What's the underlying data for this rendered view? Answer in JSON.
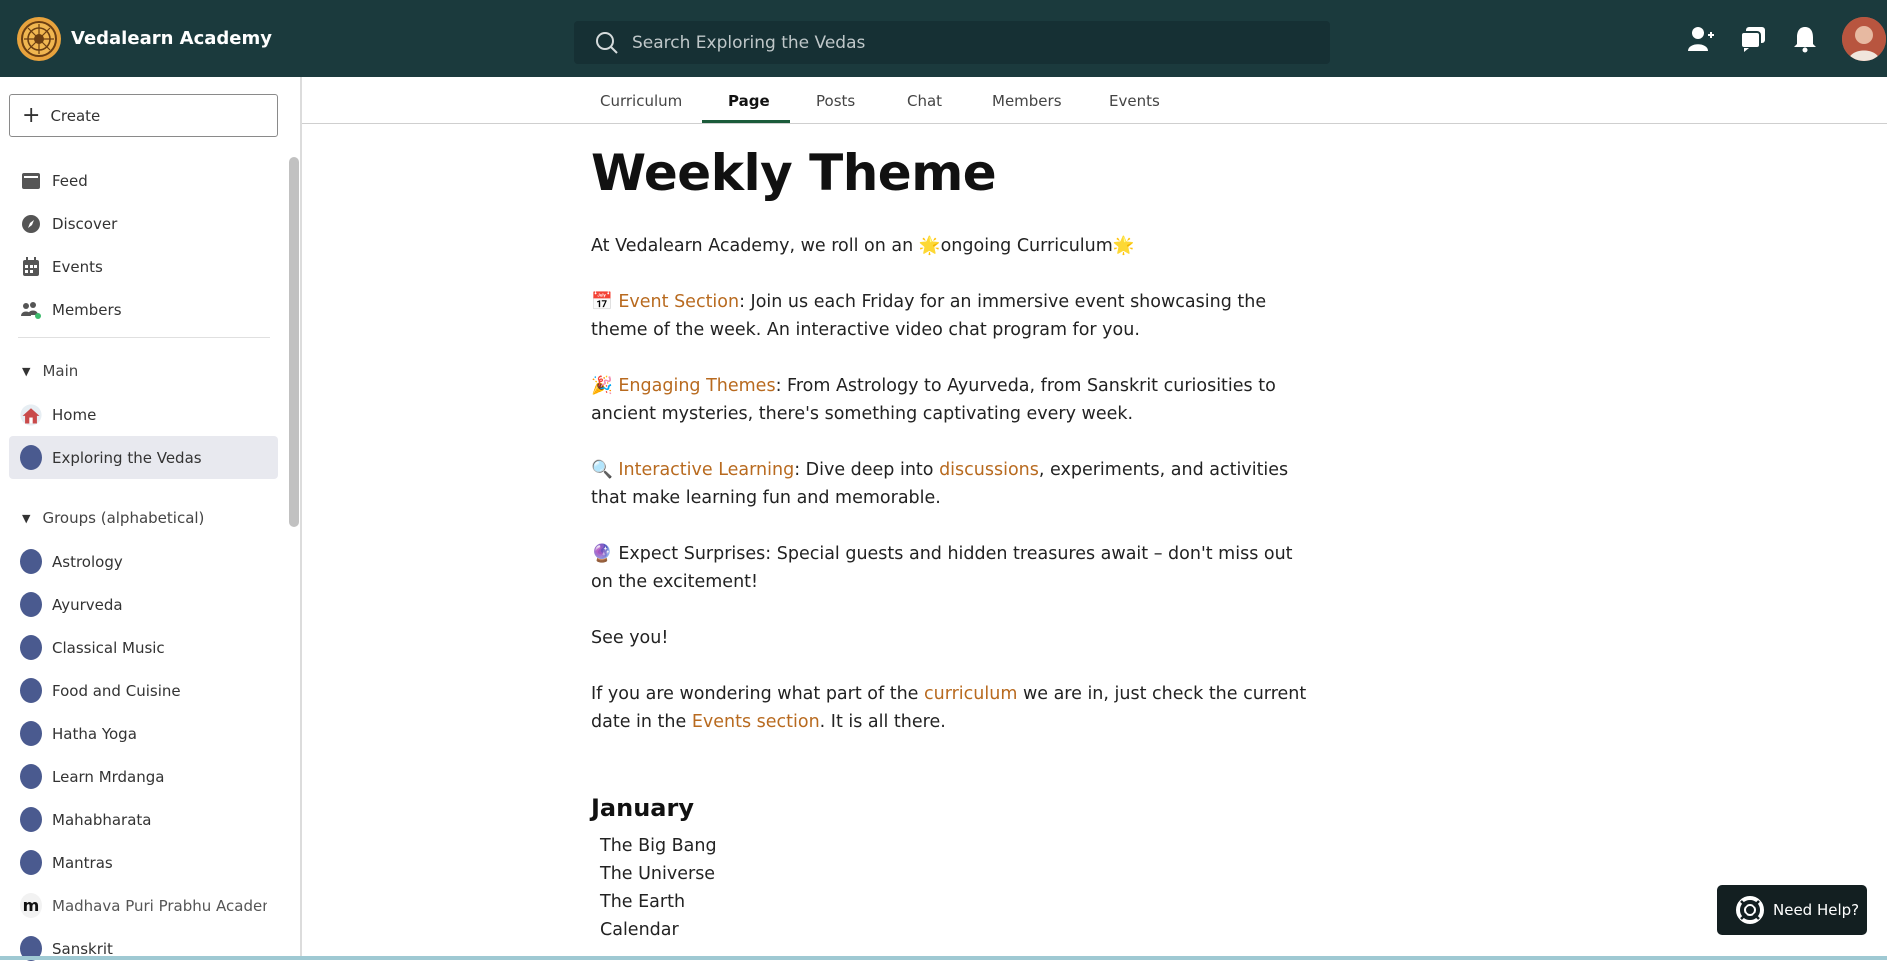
{
  "app": {
    "name": "Vedalearn Academy"
  },
  "search": {
    "placeholder": "Search Exploring the Vedas"
  },
  "sidebar": {
    "create_label": "Create",
    "nav": [
      {
        "label": "Feed",
        "icon": "feed-icon"
      },
      {
        "label": "Discover",
        "icon": "compass-icon"
      },
      {
        "label": "Events",
        "icon": "calendar-icon"
      },
      {
        "label": "Members",
        "icon": "members-icon"
      }
    ],
    "main_section": {
      "label": "Main",
      "items": [
        {
          "label": "Home",
          "icon": "home-icon"
        },
        {
          "label": "Exploring the Vedas",
          "icon": "group-dot",
          "active": true
        }
      ]
    },
    "groups_section": {
      "label": "Groups (alphabetical)",
      "items": [
        {
          "label": "Astrology"
        },
        {
          "label": "Ayurveda"
        },
        {
          "label": "Classical Music"
        },
        {
          "label": "Food and Cuisine"
        },
        {
          "label": "Hatha Yoga"
        },
        {
          "label": "Learn Mrdanga"
        },
        {
          "label": "Mahabharata"
        },
        {
          "label": "Mantras"
        },
        {
          "label": "Madhava Puri Prabhu Academ",
          "badge": "m"
        },
        {
          "label": "Sanskrit"
        }
      ]
    }
  },
  "tabs": [
    {
      "label": "Curriculum"
    },
    {
      "label": "Page",
      "active": true
    },
    {
      "label": "Posts"
    },
    {
      "label": "Chat"
    },
    {
      "label": "Members"
    },
    {
      "label": "Events"
    }
  ],
  "page": {
    "title": "Weekly Theme",
    "p1": {
      "text_a": "At Vedalearn Academy, we roll on an ",
      "emoji_a": "🌟",
      "text_b": "ongoing Curriculum",
      "emoji_b": "🌟"
    },
    "p2": {
      "emoji": "📅",
      "link": "Event Section",
      "text": ": Join us each Friday for an immersive event showcasing the theme of the week. An interactive video chat program for you."
    },
    "p3": {
      "emoji": "🎉",
      "link": "Engaging Themes",
      "text": ": From Astrology to Ayurveda, from Sanskrit curiosities to ancient mysteries, there's something captivating every week."
    },
    "p4": {
      "emoji": "🔍",
      "link": "Interactive Learning",
      "text_a": ": Dive deep into ",
      "link2": "discussions",
      "text_b": ", experiments, and activities that make learning fun and memorable."
    },
    "p5": {
      "emoji": "🔮",
      "text": "Expect Surprises: Special guests and hidden treasures await – don't miss out on the excitement!"
    },
    "p6": "See you!",
    "p7": {
      "text_a": "If you are wondering what part of the ",
      "link": "curriculum",
      "text_b": " we are in, just check the current date in the ",
      "link2": "Events section",
      "text_c": ". It is all there."
    },
    "month": "January",
    "month_items": [
      "The Big Bang",
      "The Universe",
      "The Earth",
      "Calendar"
    ]
  },
  "help": {
    "label": "Need Help?"
  }
}
